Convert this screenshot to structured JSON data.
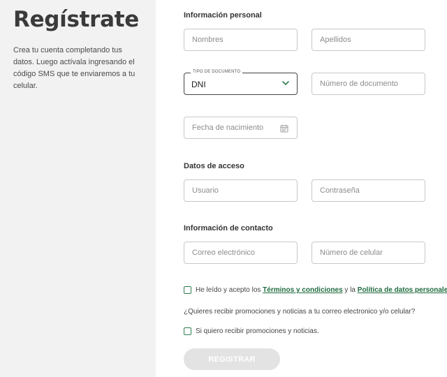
{
  "intro": {
    "title": "Regístrate",
    "description": "Crea tu cuenta completando tus datos. Luego actívala ingresando el código SMS que te enviaremos a tu celular."
  },
  "sections": {
    "personal": "Información personal",
    "access": "Datos de acceso",
    "contact": "Información de contacto"
  },
  "fields": {
    "nombres": "Nombres",
    "apellidos": "Apellidos",
    "tipo_documento_label": "TIPO DE DOCUMENTO",
    "tipo_documento_value": "DNI",
    "numero_documento": "Número de documento",
    "fecha_nacimiento": "Fecha de nacimiento",
    "usuario": "Usuario",
    "contrasena": "Contraseña",
    "correo": "Correo electrónico",
    "celular": "Número de celular"
  },
  "terms": {
    "prefix": "He leído y acepto los ",
    "terms_link": "Términos y condiciones",
    "middle": " y la ",
    "privacy_link": "Política de datos personales."
  },
  "promo": {
    "question": "¿Quieres recibir promociones y noticias a tu correo electronico y/o celular?",
    "option": "Si quiero recibir promociones y noticias."
  },
  "submit": {
    "label": "REGISTRAR"
  },
  "colors": {
    "accent": "#2e7d4f",
    "left_panel": "#f2f2f2",
    "disabled_button": "#e3e3e3"
  }
}
